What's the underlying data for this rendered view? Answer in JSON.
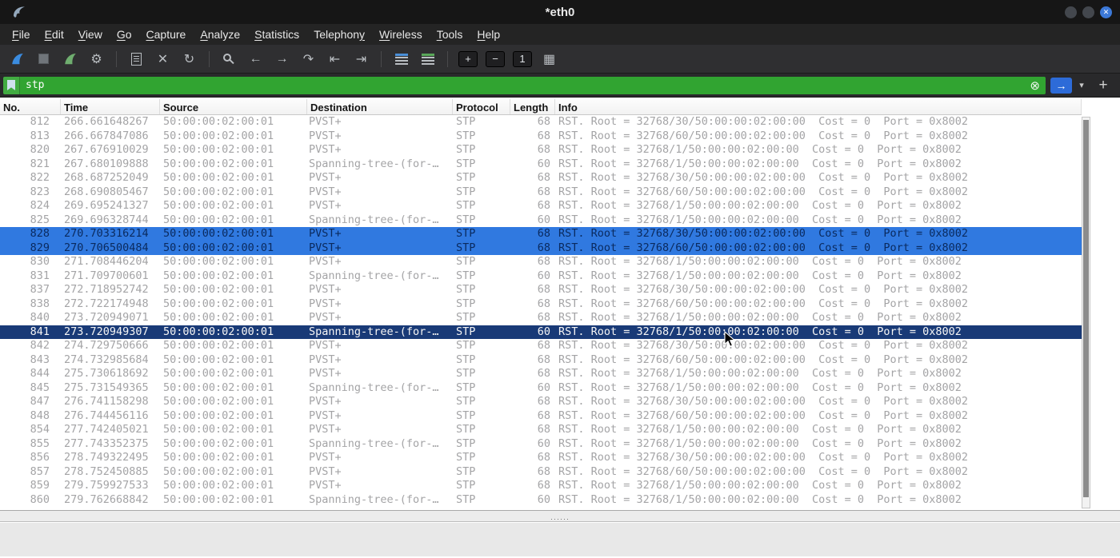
{
  "window": {
    "title": "*eth0",
    "close_glyph": "✕"
  },
  "menu": {
    "items": [
      {
        "label": "File",
        "u": 0
      },
      {
        "label": "Edit",
        "u": 0
      },
      {
        "label": "View",
        "u": 0
      },
      {
        "label": "Go",
        "u": 0
      },
      {
        "label": "Capture",
        "u": 0
      },
      {
        "label": "Analyze",
        "u": 0
      },
      {
        "label": "Statistics",
        "u": 0
      },
      {
        "label": "Telephony",
        "u": 8
      },
      {
        "label": "Wireless",
        "u": 0
      },
      {
        "label": "Tools",
        "u": 0
      },
      {
        "label": "Help",
        "u": 0
      }
    ]
  },
  "toolbar": {
    "items": [
      {
        "name": "start-capture-icon",
        "svg": "fin",
        "color": "#3b8ce0"
      },
      {
        "name": "stop-capture-icon",
        "cls": "stop"
      },
      {
        "name": "restart-capture-icon",
        "svg": "fin",
        "color": "#6fae6f"
      },
      {
        "name": "capture-options-icon",
        "glyph": "⚙"
      },
      {
        "type": "sep"
      },
      {
        "name": "open-file-icon",
        "cls": "doc"
      },
      {
        "name": "close-file-icon",
        "glyph": "✕"
      },
      {
        "name": "reload-icon",
        "glyph": "↻"
      },
      {
        "type": "sep"
      },
      {
        "name": "find-packet-icon",
        "cls": "magnifier"
      },
      {
        "name": "go-back-icon",
        "glyph": "←"
      },
      {
        "name": "go-forward-icon",
        "glyph": "→"
      },
      {
        "name": "go-to-packet-icon",
        "glyph": "↷"
      },
      {
        "name": "first-packet-icon",
        "glyph": "⇤"
      },
      {
        "name": "last-packet-icon",
        "glyph": "⇥"
      },
      {
        "type": "sep"
      },
      {
        "name": "auto-scroll-icon",
        "cls": "list1"
      },
      {
        "name": "colorize-icon",
        "cls": "list2"
      },
      {
        "type": "sep"
      },
      {
        "name": "zoom-in-icon",
        "glyph": "+",
        "btn": true
      },
      {
        "name": "zoom-out-icon",
        "glyph": "−",
        "btn": true
      },
      {
        "name": "zoom-100-icon",
        "glyph": "1",
        "btn": true
      },
      {
        "name": "resize-columns-icon",
        "glyph": "▦"
      }
    ]
  },
  "filter": {
    "value": "stp",
    "clear_glyph": "⊗",
    "apply_glyph": "→",
    "caret_glyph": "▾",
    "add_glyph": "+",
    "valid_filter_green": "#31a431"
  },
  "packet_list": {
    "columns": [
      "No.",
      "Time",
      "Source",
      "Destination",
      "Protocol",
      "Length",
      "Info"
    ],
    "rows": [
      {
        "no": "812",
        "time": "266.661648267",
        "source": "50:00:00:02:00:01",
        "destination": "PVST+",
        "protocol": "STP",
        "length": "68",
        "info": "RST. Root = 32768/30/50:00:00:02:00:00  Cost = 0  Port = 0x8002",
        "state": ""
      },
      {
        "no": "813",
        "time": "266.667847086",
        "source": "50:00:00:02:00:01",
        "destination": "PVST+",
        "protocol": "STP",
        "length": "68",
        "info": "RST. Root = 32768/60/50:00:00:02:00:00  Cost = 0  Port = 0x8002",
        "state": ""
      },
      {
        "no": "820",
        "time": "267.676910029",
        "source": "50:00:00:02:00:01",
        "destination": "PVST+",
        "protocol": "STP",
        "length": "68",
        "info": "RST. Root = 32768/1/50:00:00:02:00:00  Cost = 0  Port = 0x8002",
        "state": ""
      },
      {
        "no": "821",
        "time": "267.680109888",
        "source": "50:00:00:02:00:01",
        "destination": "Spanning-tree-(for-…",
        "protocol": "STP",
        "length": "60",
        "info": "RST. Root = 32768/1/50:00:00:02:00:00  Cost = 0  Port = 0x8002",
        "state": ""
      },
      {
        "no": "822",
        "time": "268.687252049",
        "source": "50:00:00:02:00:01",
        "destination": "PVST+",
        "protocol": "STP",
        "length": "68",
        "info": "RST. Root = 32768/30/50:00:00:02:00:00  Cost = 0  Port = 0x8002",
        "state": ""
      },
      {
        "no": "823",
        "time": "268.690805467",
        "source": "50:00:00:02:00:01",
        "destination": "PVST+",
        "protocol": "STP",
        "length": "68",
        "info": "RST. Root = 32768/60/50:00:00:02:00:00  Cost = 0  Port = 0x8002",
        "state": ""
      },
      {
        "no": "824",
        "time": "269.695241327",
        "source": "50:00:00:02:00:01",
        "destination": "PVST+",
        "protocol": "STP",
        "length": "68",
        "info": "RST. Root = 32768/1/50:00:00:02:00:00  Cost = 0  Port = 0x8002",
        "state": ""
      },
      {
        "no": "825",
        "time": "269.696328744",
        "source": "50:00:00:02:00:01",
        "destination": "Spanning-tree-(for-…",
        "protocol": "STP",
        "length": "60",
        "info": "RST. Root = 32768/1/50:00:00:02:00:00  Cost = 0  Port = 0x8002",
        "state": ""
      },
      {
        "no": "828",
        "time": "270.703316214",
        "source": "50:00:00:02:00:01",
        "destination": "PVST+",
        "protocol": "STP",
        "length": "68",
        "info": "RST. Root = 32768/30/50:00:00:02:00:00  Cost = 0  Port = 0x8002",
        "state": "sel-alt"
      },
      {
        "no": "829",
        "time": "270.706500484",
        "source": "50:00:00:02:00:01",
        "destination": "PVST+",
        "protocol": "STP",
        "length": "68",
        "info": "RST. Root = 32768/60/50:00:00:02:00:00  Cost = 0  Port = 0x8002",
        "state": "sel-alt"
      },
      {
        "no": "830",
        "time": "271.708446204",
        "source": "50:00:00:02:00:01",
        "destination": "PVST+",
        "protocol": "STP",
        "length": "68",
        "info": "RST. Root = 32768/1/50:00:00:02:00:00  Cost = 0  Port = 0x8002",
        "state": ""
      },
      {
        "no": "831",
        "time": "271.709700601",
        "source": "50:00:00:02:00:01",
        "destination": "Spanning-tree-(for-…",
        "protocol": "STP",
        "length": "60",
        "info": "RST. Root = 32768/1/50:00:00:02:00:00  Cost = 0  Port = 0x8002",
        "state": ""
      },
      {
        "no": "837",
        "time": "272.718952742",
        "source": "50:00:00:02:00:01",
        "destination": "PVST+",
        "protocol": "STP",
        "length": "68",
        "info": "RST. Root = 32768/30/50:00:00:02:00:00  Cost = 0  Port = 0x8002",
        "state": ""
      },
      {
        "no": "838",
        "time": "272.722174948",
        "source": "50:00:00:02:00:01",
        "destination": "PVST+",
        "protocol": "STP",
        "length": "68",
        "info": "RST. Root = 32768/60/50:00:00:02:00:00  Cost = 0  Port = 0x8002",
        "state": ""
      },
      {
        "no": "840",
        "time": "273.720949071",
        "source": "50:00:00:02:00:01",
        "destination": "PVST+",
        "protocol": "STP",
        "length": "68",
        "info": "RST. Root = 32768/1/50:00:00:02:00:00  Cost = 0  Port = 0x8002",
        "state": ""
      },
      {
        "no": "841",
        "time": "273.720949307",
        "source": "50:00:00:02:00:01",
        "destination": "Spanning-tree-(for-…",
        "protocol": "STP",
        "length": "60",
        "info": "RST. Root = 32768/1/50:00:00:02:00:00  Cost = 0  Port = 0x8002",
        "state": "sel"
      },
      {
        "no": "842",
        "time": "274.729750666",
        "source": "50:00:00:02:00:01",
        "destination": "PVST+",
        "protocol": "STP",
        "length": "68",
        "info": "RST. Root = 32768/30/50:00:00:02:00:00  Cost = 0  Port = 0x8002",
        "state": ""
      },
      {
        "no": "843",
        "time": "274.732985684",
        "source": "50:00:00:02:00:01",
        "destination": "PVST+",
        "protocol": "STP",
        "length": "68",
        "info": "RST. Root = 32768/60/50:00:00:02:00:00  Cost = 0  Port = 0x8002",
        "state": ""
      },
      {
        "no": "844",
        "time": "275.730618692",
        "source": "50:00:00:02:00:01",
        "destination": "PVST+",
        "protocol": "STP",
        "length": "68",
        "info": "RST. Root = 32768/1/50:00:00:02:00:00  Cost = 0  Port = 0x8002",
        "state": ""
      },
      {
        "no": "845",
        "time": "275.731549365",
        "source": "50:00:00:02:00:01",
        "destination": "Spanning-tree-(for-…",
        "protocol": "STP",
        "length": "60",
        "info": "RST. Root = 32768/1/50:00:00:02:00:00  Cost = 0  Port = 0x8002",
        "state": ""
      },
      {
        "no": "847",
        "time": "276.741158298",
        "source": "50:00:00:02:00:01",
        "destination": "PVST+",
        "protocol": "STP",
        "length": "68",
        "info": "RST. Root = 32768/30/50:00:00:02:00:00  Cost = 0  Port = 0x8002",
        "state": ""
      },
      {
        "no": "848",
        "time": "276.744456116",
        "source": "50:00:00:02:00:01",
        "destination": "PVST+",
        "protocol": "STP",
        "length": "68",
        "info": "RST. Root = 32768/60/50:00:00:02:00:00  Cost = 0  Port = 0x8002",
        "state": ""
      },
      {
        "no": "854",
        "time": "277.742405021",
        "source": "50:00:00:02:00:01",
        "destination": "PVST+",
        "protocol": "STP",
        "length": "68",
        "info": "RST. Root = 32768/1/50:00:00:02:00:00  Cost = 0  Port = 0x8002",
        "state": ""
      },
      {
        "no": "855",
        "time": "277.743352375",
        "source": "50:00:00:02:00:01",
        "destination": "Spanning-tree-(for-…",
        "protocol": "STP",
        "length": "60",
        "info": "RST. Root = 32768/1/50:00:00:02:00:00  Cost = 0  Port = 0x8002",
        "state": ""
      },
      {
        "no": "856",
        "time": "278.749322495",
        "source": "50:00:00:02:00:01",
        "destination": "PVST+",
        "protocol": "STP",
        "length": "68",
        "info": "RST. Root = 32768/30/50:00:00:02:00:00  Cost = 0  Port = 0x8002",
        "state": ""
      },
      {
        "no": "857",
        "time": "278.752450885",
        "source": "50:00:00:02:00:01",
        "destination": "PVST+",
        "protocol": "STP",
        "length": "68",
        "info": "RST. Root = 32768/60/50:00:00:02:00:00  Cost = 0  Port = 0x8002",
        "state": ""
      },
      {
        "no": "859",
        "time": "279.759927533",
        "source": "50:00:00:02:00:01",
        "destination": "PVST+",
        "protocol": "STP",
        "length": "68",
        "info": "RST. Root = 32768/1/50:00:00:02:00:00  Cost = 0  Port = 0x8002",
        "state": ""
      },
      {
        "no": "860",
        "time": "279.762668842",
        "source": "50:00:00:02:00:01",
        "destination": "Spanning-tree-(for-…",
        "protocol": "STP",
        "length": "60",
        "info": "RST. Root = 32768/1/50:00:00:02:00:00  Cost = 0  Port = 0x8002",
        "state": ""
      }
    ],
    "selection_colors": {
      "primary_bg": "#193a77",
      "secondary_bg": "#3079e0",
      "dimmed_text": "#a4a4a6"
    }
  },
  "ui": {
    "splitter_dots": "······"
  }
}
